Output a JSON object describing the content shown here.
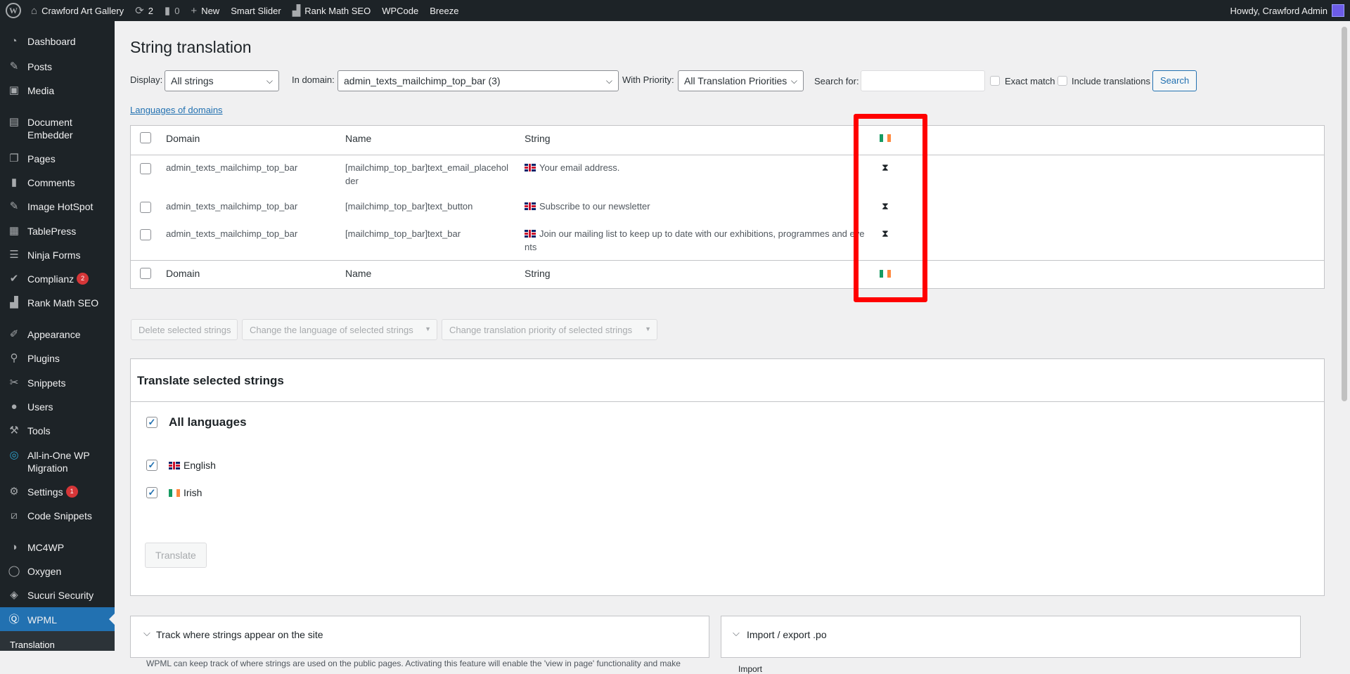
{
  "adminbar": {
    "site_name": "Crawford Art Gallery",
    "updates_count": "2",
    "comments_count": "0",
    "new_label": "New",
    "smart_slider": "Smart Slider",
    "rank_math": "Rank Math SEO",
    "wpcode": "WPCode",
    "breeze": "Breeze",
    "howdy": "Howdy, Crawford Admin"
  },
  "sidebar": {
    "items": [
      {
        "label": "Dashboard",
        "icon": "dashboard-icon"
      },
      {
        "label": "Posts",
        "icon": "pin-icon"
      },
      {
        "label": "Media",
        "icon": "media-icon"
      },
      {
        "label": "Document Embedder",
        "icon": "document-icon"
      },
      {
        "label": "Pages",
        "icon": "pages-icon"
      },
      {
        "label": "Comments",
        "icon": "comments-icon"
      },
      {
        "label": "Image HotSpot",
        "icon": "pin-icon"
      },
      {
        "label": "TablePress",
        "icon": "table-icon"
      },
      {
        "label": "Ninja Forms",
        "icon": "forms-icon"
      },
      {
        "label": "Complianz",
        "icon": "check-icon",
        "badge": "2"
      },
      {
        "label": "Rank Math SEO",
        "icon": "chart-icon"
      },
      {
        "label": "Appearance",
        "icon": "brush-icon"
      },
      {
        "label": "Plugins",
        "icon": "plugin-icon"
      },
      {
        "label": "Snippets",
        "icon": "scissors-icon"
      },
      {
        "label": "Users",
        "icon": "user-icon"
      },
      {
        "label": "Tools",
        "icon": "wrench-icon"
      },
      {
        "label": "All-in-One WP Migration",
        "icon": "migration-icon"
      },
      {
        "label": "Settings",
        "icon": "settings-icon",
        "badge": "1"
      },
      {
        "label": "Code Snippets",
        "icon": "code-icon"
      },
      {
        "label": "MC4WP",
        "icon": "mail-icon"
      },
      {
        "label": "Oxygen",
        "icon": "oxygen-icon"
      },
      {
        "label": "Sucuri Security",
        "icon": "shield-icon"
      },
      {
        "label": "WPML",
        "icon": "wpml-icon"
      }
    ],
    "submenu_label": "Translation"
  },
  "page": {
    "title": "String translation",
    "display_label": "Display:",
    "display_value": "All strings",
    "domain_label": "In domain:",
    "domain_value": "admin_texts_mailchimp_top_bar (3)",
    "priority_label": "With Priority:",
    "priority_value": "All Translation Priorities",
    "search_label": "Search for:",
    "search_value": "",
    "exact_match": "Exact match",
    "include_translations": "Include translations",
    "search_button": "Search",
    "languages_link": "Languages of domains"
  },
  "table": {
    "headers": {
      "domain": "Domain",
      "name": "Name",
      "string": "String"
    },
    "rows": [
      {
        "domain": "admin_texts_mailchimp_top_bar",
        "name_line1": "[mailchimp_top_bar]text_email_placehol",
        "name_line2": "der",
        "string_line1": "Your email address.",
        "string_line2": ""
      },
      {
        "domain": "admin_texts_mailchimp_top_bar",
        "name_line1": "[mailchimp_top_bar]text_button",
        "name_line2": "",
        "string_line1": "Subscribe to our newsletter",
        "string_line2": ""
      },
      {
        "domain": "admin_texts_mailchimp_top_bar",
        "name_line1": "[mailchimp_top_bar]text_bar",
        "name_line2": "",
        "string_line1": "Join our mailing list to keep up to date with our exhibitions, programmes and eve",
        "string_line2": "nts"
      }
    ],
    "status_icon": "hourglass-icon"
  },
  "bulk_actions": {
    "delete": "Delete selected strings",
    "change_language": "Change the language of selected strings",
    "change_priority": "Change translation priority of selected strings"
  },
  "translate_panel": {
    "title": "Translate selected strings",
    "all_languages": "All languages",
    "languages": [
      "English",
      "Irish"
    ],
    "translate_button": "Translate"
  },
  "track_panel": {
    "title": "Track where strings appear on the site",
    "description": "WPML can keep track of where strings are used on the public pages. Activating this feature will enable the 'view in page' functionality and make"
  },
  "import_panel": {
    "title": "Import / export .po",
    "import_label": "Import"
  },
  "colors": {
    "highlight_box": "#ff0000",
    "accent": "#2271b1",
    "adminbar_bg": "#1d2327"
  }
}
